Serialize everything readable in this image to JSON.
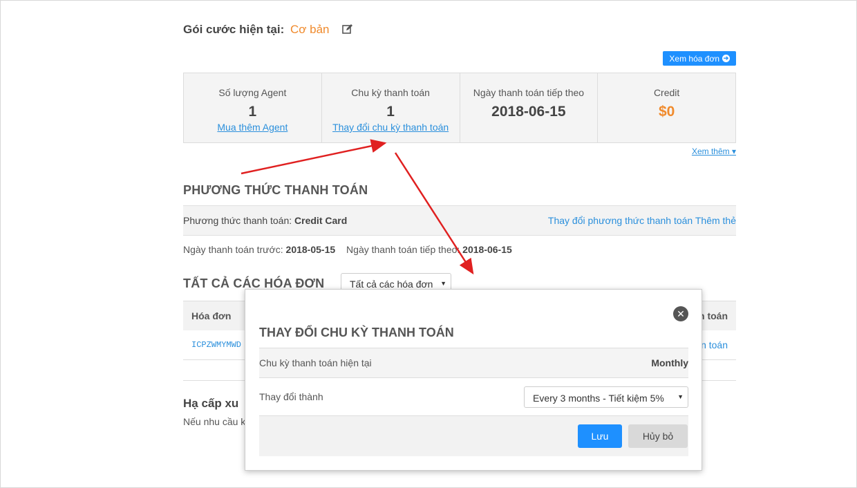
{
  "plan": {
    "label": "Gói cước hiện tại:",
    "name": "Cơ bản"
  },
  "buttons": {
    "view_invoice": "Xem hóa đơn",
    "see_more": "Xem thêm"
  },
  "stats": [
    {
      "label": "Số lượng Agent",
      "value": "1",
      "link": "Mua thêm Agent"
    },
    {
      "label": "Chu kỳ thanh toán",
      "value": "1",
      "link": "Thay đổi chu kỳ thanh toán"
    },
    {
      "label": "Ngày thanh toán tiếp theo",
      "value": "2018-06-15",
      "link": ""
    },
    {
      "label": "Credit",
      "value": "$0",
      "link": ""
    }
  ],
  "payment": {
    "title": "PHƯƠNG THỨC THANH TOÁN",
    "method_label": "Phương thức thanh toán:",
    "method_value": "Credit Card",
    "change_link": "Thay đổi phương thức thanh toán",
    "add_link": "Thêm thẻ",
    "prev_label": "Ngày thanh toán trước:",
    "prev_value": "2018-05-15",
    "next_label": "Ngày thanh toán tiếp theo:",
    "next_value": "2018-06-15"
  },
  "invoices": {
    "title": "TẤT CẢ CÁC HÓA ĐƠN",
    "filter": "Tất cả các hóa đơn",
    "col_invoice": "Hóa đơn",
    "col_pay": "n toán",
    "row_code": "ICPZWMYMWD",
    "row_action": "n toán"
  },
  "downgrade": {
    "title": "Hạ cấp xu",
    "text": "Nếu nhu cầu k"
  },
  "modal": {
    "title": "THAY ĐỔI CHU KỲ THANH TOÁN",
    "current_label": "Chu kỳ thanh toán hiện tại",
    "current_value": "Monthly",
    "change_label": "Thay đổi thành",
    "change_value": "Every 3 months - Tiết kiệm 5%",
    "save": "Lưu",
    "cancel": "Hủy bỏ",
    "close_glyph": "✕"
  },
  "colors": {
    "accent": "#1e90ff",
    "orange": "#f08a2c",
    "link": "#2a8fdc",
    "annotation": "#e02020"
  }
}
